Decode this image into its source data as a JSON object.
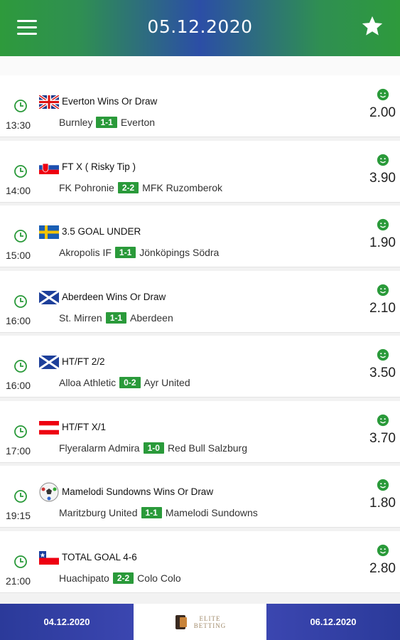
{
  "header": {
    "date": "05.12.2020",
    "menu_icon": "hamburger-icon",
    "favorite_icon": "star-icon"
  },
  "colors": {
    "green": "#2a9a3a",
    "blue": "#2c3ea0"
  },
  "tips": [
    {
      "time": "13:30",
      "flag": "uk-flag-icon",
      "tip": "Everton Wins Or Draw",
      "home": "Burnley",
      "score": "1-1",
      "away": "Everton",
      "odds": "2.00"
    },
    {
      "time": "14:00",
      "flag": "slovakia-flag-icon",
      "tip": "FT X ( Risky Tip )",
      "home": "FK Pohronie",
      "score": "2-2",
      "away": "MFK Ruzomberok",
      "odds": "3.90"
    },
    {
      "time": "15:00",
      "flag": "sweden-flag-icon",
      "tip": "3.5 GOAL UNDER",
      "home": "Akropolis IF",
      "score": "1-1",
      "away": "Jönköpings Södra",
      "odds": "1.90"
    },
    {
      "time": "16:00",
      "flag": "scotland-flag-icon",
      "tip": "Aberdeen Wins Or Draw",
      "home": "St. Mirren",
      "score": "1-1",
      "away": "Aberdeen",
      "odds": "2.10"
    },
    {
      "time": "16:00",
      "flag": "scotland-flag-icon",
      "tip": "HT/FT 2/2",
      "home": "Alloa Athletic",
      "score": "0-2",
      "away": "Ayr United",
      "odds": "3.50"
    },
    {
      "time": "17:00",
      "flag": "austria-flag-icon",
      "tip": "HT/FT X/1",
      "home": "Flyeralarm Admira",
      "score": "1-0",
      "away": "Red Bull Salzburg",
      "odds": "3.70"
    },
    {
      "time": "19:15",
      "flag": "football-icon",
      "tip": "Mamelodi Sundowns Wins Or Draw",
      "home": "Maritzburg United",
      "score": "1-1",
      "away": "Mamelodi Sundowns",
      "odds": "1.80"
    },
    {
      "time": "21:00",
      "flag": "chile-flag-icon",
      "tip": "TOTAL GOAL 4-6",
      "home": "Huachipato",
      "score": "2-2",
      "away": "Colo Colo",
      "odds": "2.80"
    }
  ],
  "footer": {
    "prev_date": "04.12.2020",
    "next_date": "06.12.2020",
    "logo_line1": "ELITE",
    "logo_line2": "BETTING"
  }
}
